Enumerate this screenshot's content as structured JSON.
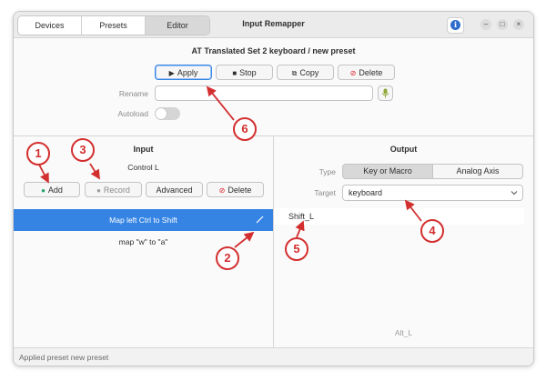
{
  "header": {
    "tabs": [
      {
        "label": "Devices"
      },
      {
        "label": "Presets"
      },
      {
        "label": "Editor",
        "active": true
      }
    ],
    "title": "Input Remapper",
    "info_icon": "info-icon",
    "window_controls": {
      "minimize": "–",
      "maximize": "□",
      "close": "×"
    }
  },
  "editor": {
    "preset_title": "AT Translated Set 2 keyboard  /  new preset",
    "buttons": {
      "apply": "Apply",
      "stop": "Stop",
      "copy": "Copy",
      "delete": "Delete"
    },
    "rename_label": "Rename",
    "rename_value": "",
    "autoload_label": "Autoload",
    "autoload_on": false
  },
  "input": {
    "heading": "Input",
    "current_event": "Control L",
    "buttons": {
      "add": "Add",
      "record": "Record",
      "advanced": "Advanced",
      "delete": "Delete"
    },
    "mappings": [
      {
        "label": "Map left Ctrl to Shift",
        "selected": true
      },
      {
        "label": "map \"w\" to \"a\"",
        "selected": false
      }
    ]
  },
  "output": {
    "heading": "Output",
    "type_label": "Type",
    "type_options": [
      "Key or Macro",
      "Analog Axis"
    ],
    "type_selected": "Key or Macro",
    "target_label": "Target",
    "target_value": "keyboard",
    "value": "Shift_L",
    "hint": "Alt_L"
  },
  "status": {
    "text": "Applied preset new preset"
  },
  "annotations": {
    "n1": "1",
    "n2": "2",
    "n3": "3",
    "n4": "4",
    "n5": "5",
    "n6": "6",
    "color": "#d32f2f"
  },
  "colors": {
    "accent": "#3584e4",
    "delete_icon": "#e01b24",
    "add_icon": "#26a269"
  }
}
